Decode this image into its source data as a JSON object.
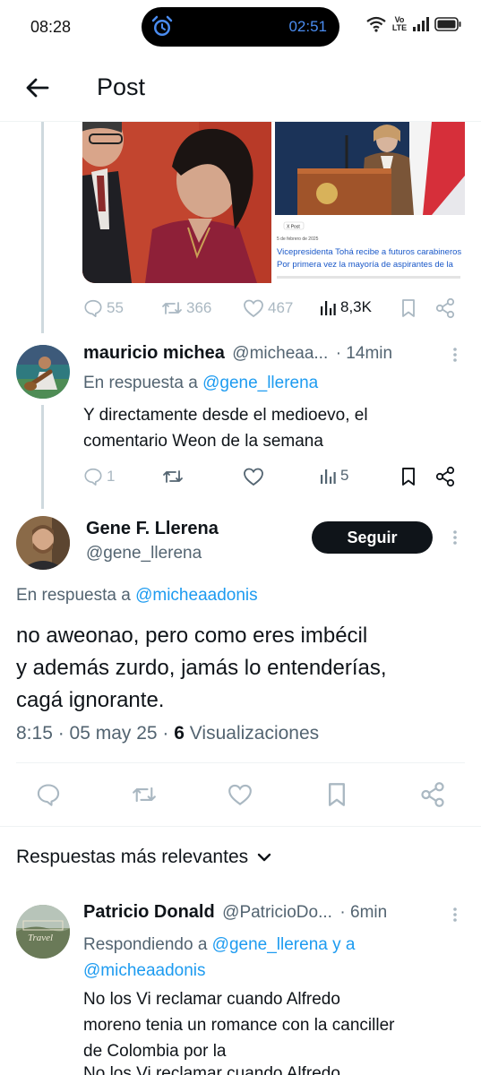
{
  "status_bar": {
    "time": "08:28",
    "timer": "02:51",
    "volte": "Vo LTE",
    "icons": [
      "alarm-icon",
      "wifi-icon",
      "volte-icon",
      "signal-icon",
      "battery-icon"
    ]
  },
  "header": {
    "title": "Post",
    "back_icon": "arrow-left-icon"
  },
  "previous_post": {
    "media_caption_line1": "Vicepresidenta Tohá recibe a futuros carabineros",
    "media_caption_line2": "Por primera vez la mayoría de aspirantes de la",
    "media_date": "5 de febrero de 2025",
    "media_tag": "X Post",
    "stats": {
      "replies": "55",
      "reposts": "366",
      "likes": "467",
      "views": "8,3K"
    }
  },
  "reply_1": {
    "author_name": "mauricio michea",
    "author_handle": "@micheaa...",
    "time": "· 14min",
    "reply_prefix": "En respuesta a",
    "reply_target": "@gene_llerena",
    "text_line1": "Y directamente desde el medioevo, el",
    "text_line2": "comentario Weon de la semana",
    "stats": {
      "replies": "1",
      "reposts": "",
      "likes": "",
      "views": "5"
    }
  },
  "main_post": {
    "author_name": "Gene F. Llerena",
    "author_handle": "@gene_llerena",
    "follow_label": "Seguir",
    "reply_prefix": "En respuesta a",
    "reply_target": "@micheaadonis",
    "text_line1": "no aweonao, pero como eres imbécil",
    "text_line2": "y además zurdo, jamás lo entenderías,",
    "text_line3": "cagá ignorante.",
    "time": "8:15 · 05 may 25 · ",
    "views_count": "6",
    "views_label": "Visualizaciones"
  },
  "replies_section": {
    "sort_label": "Respuestas más relevantes"
  },
  "reply_2": {
    "author_name": "Patricio Donald",
    "author_handle": "@PatricioDo...",
    "time": "· 6min",
    "reply_prefix": "Respondiendo a",
    "reply_target_1": "@gene_llerena",
    "reply_joiner": "y a",
    "reply_target_2": "@micheaadonis",
    "avatar_text": "Travel",
    "text_line1": "No los Vi reclamar cuando Alfredo",
    "text_line2": "moreno tenia un romance con la canciller",
    "text_line3": "de Colombia por la",
    "text_line4": "No los Vi reclamar cuando Alfredo"
  },
  "colors": {
    "accent": "#1d9bf0",
    "text": "#0f1419",
    "muted": "#536471",
    "faded_icon": "#aab8c2",
    "follow_bg": "#0f1419",
    "thread_line": "#cfd9de"
  }
}
